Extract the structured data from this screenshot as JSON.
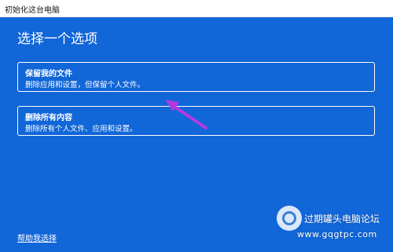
{
  "window": {
    "title": "初始化这台电脑"
  },
  "main": {
    "heading": "选择一个选项",
    "options": [
      {
        "title": "保留我的文件",
        "description": "删除应用和设置，但保留个人文件。"
      },
      {
        "title": "删除所有内容",
        "description": "删除所有个人文件、应用和设置。"
      }
    ],
    "help_link": "帮助我选择"
  },
  "annotation": {
    "arrow_color": "#b23be0"
  },
  "watermark": {
    "line1": "过期罐头电脑论坛",
    "line2": "www.gqgtpc.com"
  }
}
